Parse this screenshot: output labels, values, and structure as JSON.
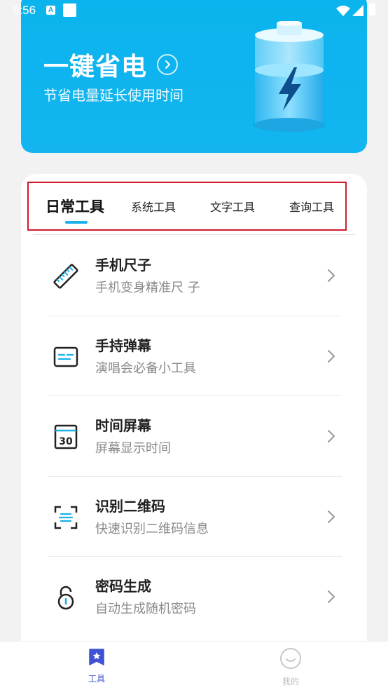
{
  "status_bar": {
    "time": "9:56",
    "a_badge": "A"
  },
  "banner": {
    "title": "一键省电",
    "subtitle": "节省电量延长使用时间",
    "arrow_icon": "chevron-circle-right-icon",
    "illustration": "battery-charging-icon"
  },
  "tabs": [
    {
      "label": "日常工具",
      "active": true
    },
    {
      "label": "系统工具",
      "active": false
    },
    {
      "label": "文字工具",
      "active": false
    },
    {
      "label": "查询工具",
      "active": false
    }
  ],
  "tools": [
    {
      "title": "手机尺子",
      "desc": "手机变身精准尺 子",
      "icon": "ruler-icon"
    },
    {
      "title": "手持弹幕",
      "desc": "演唱会必备小工具",
      "icon": "barrage-icon"
    },
    {
      "title": "时间屏幕",
      "desc": "屏幕显示时间",
      "icon": "calendar-30-icon",
      "icon_text": "30"
    },
    {
      "title": "识别二维码",
      "desc": "快速识别二维码信息",
      "icon": "qr-scan-icon"
    },
    {
      "title": "密码生成",
      "desc": "自动生成随机密码",
      "icon": "lock-icon"
    }
  ],
  "bottom_nav": {
    "tools_label": "工具",
    "mine_label": "我的"
  },
  "colors": {
    "banner": "#0bb4ee",
    "accent": "#1ab0e8",
    "nav_active": "#3f51d5",
    "highlight_box": "#d11a2a"
  }
}
